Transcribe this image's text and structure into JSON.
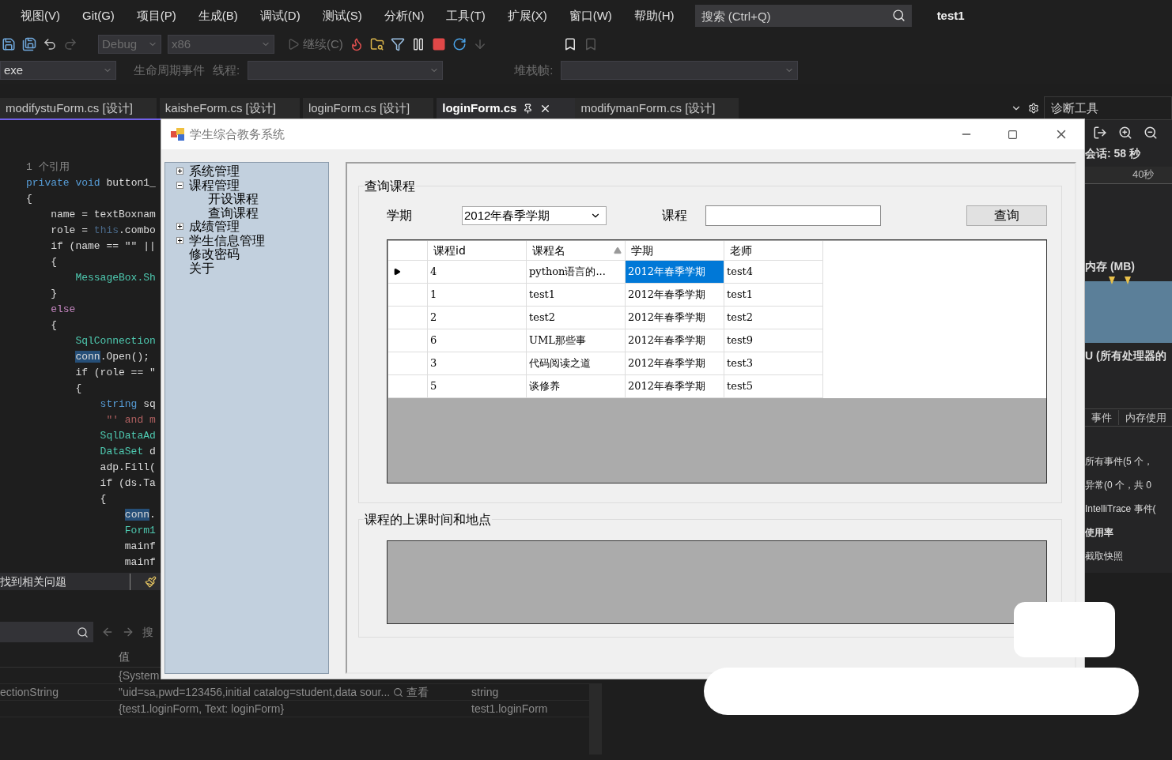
{
  "menu": [
    {
      "label": "视图(V)"
    },
    {
      "label": "Git(G)"
    },
    {
      "label": "项目(P)"
    },
    {
      "label": "生成(B)"
    },
    {
      "label": "调试(D)"
    },
    {
      "label": "测试(S)"
    },
    {
      "label": "分析(N)"
    },
    {
      "label": "工具(T)"
    },
    {
      "label": "扩展(X)"
    },
    {
      "label": "窗口(W)"
    },
    {
      "label": "帮助(H)"
    }
  ],
  "search": {
    "placeholder": "搜索 (Ctrl+Q)"
  },
  "solution_name": "test1",
  "toolbar": {
    "configuration": "Debug",
    "platform": "x86",
    "continue": "继续(C)"
  },
  "debug_toolbar": {
    "process": "exe",
    "lifecycle": "生命周期事件",
    "thread_label": "线程:",
    "stack_label": "堆栈帧:"
  },
  "doc_tabs": [
    {
      "label": "modifystuForm.cs [设计]",
      "selected": false
    },
    {
      "label": "kaisheForm.cs [设计]",
      "selected": false
    },
    {
      "label": "loginForm.cs [设计]",
      "selected": false
    },
    {
      "label": "loginForm.cs",
      "selected": true
    },
    {
      "label": "modifymanForm.cs [设计]",
      "selected": false
    }
  ],
  "code_lines": [
    [
      {
        "kind": "lens",
        "text": "1 个引用"
      }
    ],
    [
      {
        "kind": "keyword",
        "text": "private void "
      },
      {
        "kind": "plain",
        "text": "button1_"
      }
    ],
    [
      {
        "kind": "plain",
        "text": "{"
      }
    ],
    [
      {
        "kind": "plain",
        "text": "    name = textBoxnam"
      }
    ],
    [
      {
        "kind": "plain",
        "text": "    role = "
      },
      {
        "kind": "dim",
        "text": "this"
      },
      {
        "kind": "plain",
        "text": ".combo"
      }
    ],
    [
      {
        "kind": "plain",
        "text": "    if (name == \"\" ||"
      }
    ],
    [
      {
        "kind": "plain",
        "text": "    {"
      }
    ],
    [
      {
        "kind": "type",
        "text": "        MessageBox.Sh"
      }
    ],
    [
      {
        "kind": "plain",
        "text": "    }"
      }
    ],
    [
      {
        "kind": "control",
        "text": "    else"
      }
    ],
    [
      {
        "kind": "plain",
        "text": "    {"
      }
    ],
    [
      {
        "kind": "type",
        "text": "        SqlConnection"
      }
    ],
    [
      {
        "kind": "highlight",
        "text": "        conn"
      },
      {
        "kind": "plain",
        "text": ".Open();"
      }
    ],
    [
      {
        "kind": "plain",
        "text": "        if (role == \""
      }
    ],
    [
      {
        "kind": "plain",
        "text": "        {"
      }
    ],
    [
      {
        "kind": "keyword",
        "text": "            string "
      },
      {
        "kind": "plain",
        "text": "sq"
      }
    ],
    [
      {
        "kind": "string",
        "text": "             \"' and m"
      }
    ],
    [
      {
        "kind": "type",
        "text": "            SqlDataAd"
      }
    ],
    [
      {
        "kind": "type",
        "text": "            DataSet "
      },
      {
        "kind": "plain",
        "text": "d"
      }
    ],
    [
      {
        "kind": "plain",
        "text": "            adp.Fill("
      }
    ],
    [
      {
        "kind": "plain",
        "text": "            if (ds.Ta"
      }
    ],
    [
      {
        "kind": "plain",
        "text": "            {"
      }
    ],
    [
      {
        "kind": "highlight",
        "text": "                conn"
      },
      {
        "kind": "plain",
        "text": "."
      }
    ],
    [
      {
        "kind": "type",
        "text": "                Form1"
      }
    ],
    [
      {
        "kind": "plain",
        "text": "                mainf"
      }
    ],
    [
      {
        "kind": "plain",
        "text": "                mainf"
      }
    ]
  ],
  "error_bar": {
    "text": "找到相关问题"
  },
  "autos": {
    "search_label": "搜",
    "header": "值",
    "rows": [
      {
        "value": "{System"
      },
      {
        "name": "ectionString",
        "value": "\"uid=sa,pwd=123456,initial catalog=student,data sour...",
        "view": "查看",
        "type": "string"
      },
      {
        "value": "{test1.loginForm, Text: loginForm}",
        "type": "test1.loginForm"
      }
    ]
  },
  "diagnostics": {
    "title": "诊断工具",
    "session": "会话: 58 秒",
    "ruler": "40秒",
    "memory_title": "内存 (MB)",
    "cpu_title": "U (所有处理器的",
    "tabs": [
      {
        "label": "事件",
        "selected": false
      },
      {
        "label": "内存使用",
        "selected": false
      }
    ],
    "items": [
      {
        "text": "所有事件(5 个，",
        "bold": false
      },
      {
        "text": "异常(0 个，共 0",
        "bold": false
      },
      {
        "text": "IntelliTrace 事件(",
        "bold": false
      },
      {
        "text": "使用率",
        "bold": true
      },
      {
        "text": "截取快照",
        "bold": false
      }
    ]
  },
  "form": {
    "title": "学生综合教务系统",
    "tree": [
      {
        "label": "系统管理",
        "kind": "node",
        "expanded": false
      },
      {
        "label": "课程管理",
        "kind": "node",
        "expanded": true,
        "children": [
          {
            "label": "开设课程"
          },
          {
            "label": "查询课程"
          }
        ]
      },
      {
        "label": "成绩管理",
        "kind": "node",
        "expanded": false
      },
      {
        "label": "学生信息管理",
        "kind": "node",
        "expanded": false
      },
      {
        "label": "修改密码",
        "kind": "leaf"
      },
      {
        "label": "关于",
        "kind": "leaf"
      }
    ],
    "query_group": {
      "title": "查询课程",
      "term_label": "学期",
      "term_value": "2012年春季学期",
      "course_label": "课程",
      "query_button": "查询",
      "columns": [
        {
          "label": "课程id",
          "sorted": false
        },
        {
          "label": "课程名",
          "sorted": true
        },
        {
          "label": "学期",
          "sorted": false
        },
        {
          "label": "老师",
          "sorted": false
        }
      ],
      "rows": [
        {
          "current": true,
          "cells": [
            {
              "text": "4",
              "selected": false
            },
            {
              "text": "python语言的...",
              "selected": false
            },
            {
              "text": "2012年春季学期",
              "selected": true
            },
            {
              "text": "test4",
              "selected": false
            }
          ]
        },
        {
          "current": false,
          "cells": [
            {
              "text": "1",
              "selected": false
            },
            {
              "text": "test1",
              "selected": false
            },
            {
              "text": "2012年春季学期",
              "selected": false
            },
            {
              "text": "test1",
              "selected": false
            }
          ]
        },
        {
          "current": false,
          "cells": [
            {
              "text": "2",
              "selected": false
            },
            {
              "text": "test2",
              "selected": false
            },
            {
              "text": "2012年春季学期",
              "selected": false
            },
            {
              "text": "test2",
              "selected": false
            }
          ]
        },
        {
          "current": false,
          "cells": [
            {
              "text": "6",
              "selected": false
            },
            {
              "text": "UML那些事",
              "selected": false
            },
            {
              "text": "2012年春季学期",
              "selected": false
            },
            {
              "text": "test9",
              "selected": false
            }
          ]
        },
        {
          "current": false,
          "cells": [
            {
              "text": "3",
              "selected": false
            },
            {
              "text": "代码阅读之道",
              "selected": false
            },
            {
              "text": "2012年春季学期",
              "selected": false
            },
            {
              "text": "test3",
              "selected": false
            }
          ]
        },
        {
          "current": false,
          "cells": [
            {
              "text": "5",
              "selected": false
            },
            {
              "text": "谈修养",
              "selected": false
            },
            {
              "text": "2012年春季学期",
              "selected": false
            },
            {
              "text": "test5",
              "selected": false
            }
          ]
        }
      ]
    },
    "schedule_group": {
      "title": "课程的上课时间和地点"
    }
  }
}
